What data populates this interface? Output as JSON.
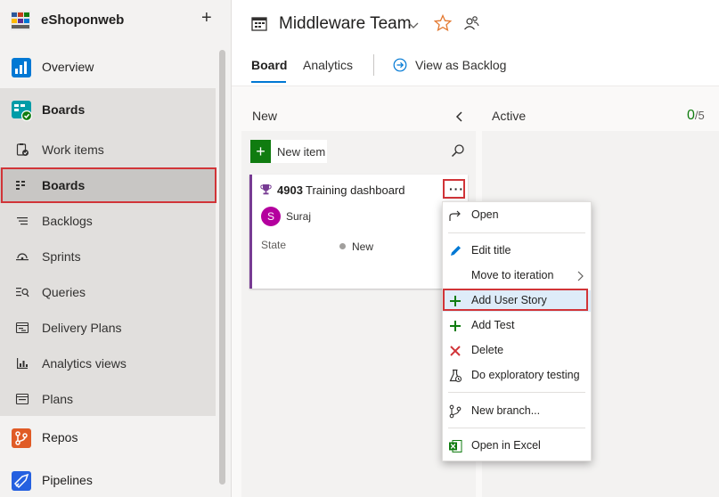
{
  "org": {
    "name": "eShoponweb",
    "add_label": "+"
  },
  "nav": {
    "overview": "Overview",
    "boards_section": "Boards",
    "boards_sub": {
      "work_items": "Work items",
      "boards": "Boards",
      "backlogs": "Backlogs",
      "sprints": "Sprints",
      "queries": "Queries",
      "delivery_plans": "Delivery Plans",
      "analytics_views": "Analytics views",
      "plans": "Plans"
    },
    "repos": "Repos",
    "pipelines": "Pipelines"
  },
  "header": {
    "team": "Middleware Team",
    "tabs": {
      "board": "Board",
      "analytics": "Analytics"
    },
    "view_as_backlog": "View as Backlog"
  },
  "columns": {
    "new": {
      "title": "New"
    },
    "active": {
      "title": "Active",
      "count": "0",
      "limit": "/5"
    }
  },
  "new_item": {
    "label": "New item"
  },
  "card": {
    "id": "4903",
    "title": "Training dashboard",
    "assignee_initial": "S",
    "assignee": "Suraj",
    "state_label": "State",
    "state_value": "New"
  },
  "menu": {
    "open": "Open",
    "edit_title": "Edit title",
    "move_to_iteration": "Move to iteration",
    "add_user_story": "Add User Story",
    "add_test": "Add Test",
    "delete": "Delete",
    "exploratory": "Do exploratory testing",
    "new_branch": "New branch...",
    "open_excel": "Open in Excel"
  },
  "colors": {
    "accent": "#0078d4",
    "highlight_red": "#d13438",
    "user_story_purple": "#773b93",
    "add_green": "#107c10"
  }
}
